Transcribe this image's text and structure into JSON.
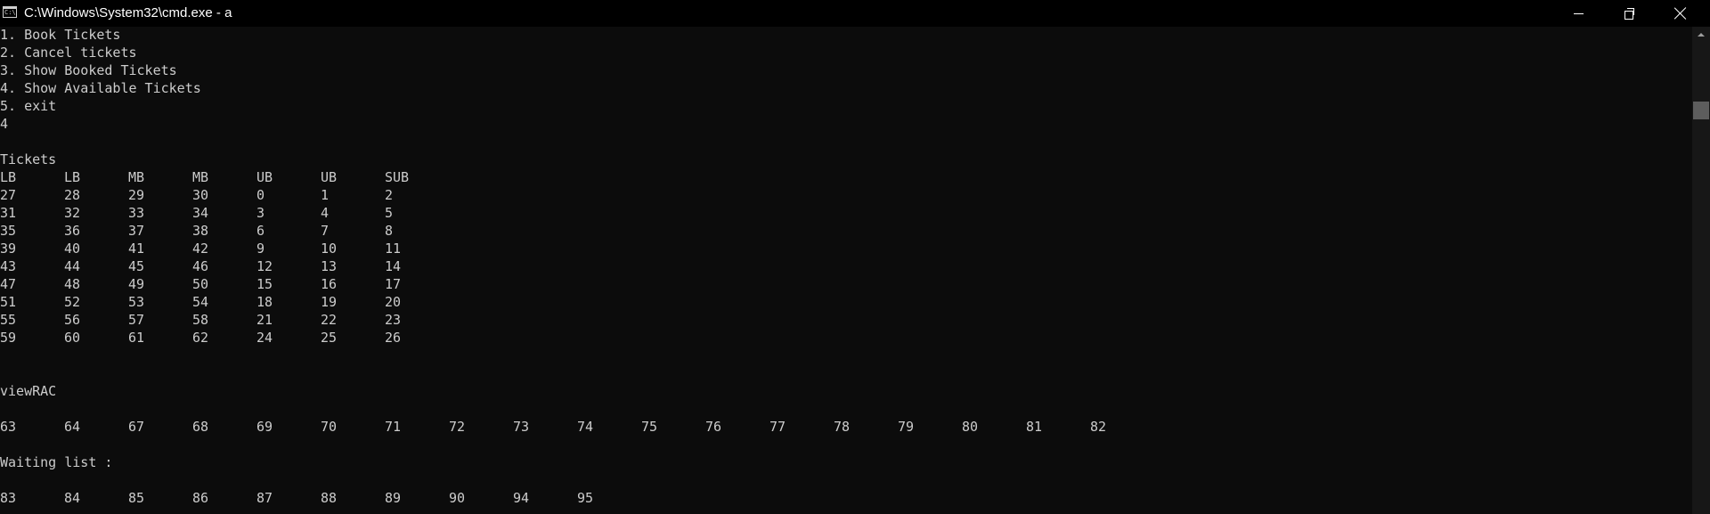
{
  "window": {
    "title": "C:\\Windows\\System32\\cmd.exe - a",
    "icon_text": "C:\\",
    "controls": [
      "minimize-icon",
      "restore-icon",
      "close-icon"
    ]
  },
  "colors": {
    "background": "#0c0c0c",
    "text": "#cccccc",
    "titlebar": "#000000"
  },
  "console": {
    "menu": [
      "1. Book Tickets",
      "2. Cancel tickets",
      "3. Show Booked Tickets",
      "4. Show Available Tickets",
      "5. exit"
    ],
    "input": "4",
    "tickets_heading": "Tickets",
    "tickets_header": [
      "LB",
      "LB",
      "MB",
      "MB",
      "UB",
      "UB",
      "SUB"
    ],
    "tickets_rows": [
      [
        "27",
        "28",
        "29",
        "30",
        "0",
        "1",
        "2"
      ],
      [
        "31",
        "32",
        "33",
        "34",
        "3",
        "4",
        "5"
      ],
      [
        "35",
        "36",
        "37",
        "38",
        "6",
        "7",
        "8"
      ],
      [
        "39",
        "40",
        "41",
        "42",
        "9",
        "10",
        "11"
      ],
      [
        "43",
        "44",
        "45",
        "46",
        "12",
        "13",
        "14"
      ],
      [
        "47",
        "48",
        "49",
        "50",
        "15",
        "16",
        "17"
      ],
      [
        "51",
        "52",
        "53",
        "54",
        "18",
        "19",
        "20"
      ],
      [
        "55",
        "56",
        "57",
        "58",
        "21",
        "22",
        "23"
      ],
      [
        "59",
        "60",
        "61",
        "62",
        "24",
        "25",
        "26"
      ]
    ],
    "rac_heading": "viewRAC",
    "rac": [
      "63",
      "64",
      "67",
      "68",
      "69",
      "70",
      "71",
      "72",
      "73",
      "74",
      "75",
      "76",
      "77",
      "78",
      "79",
      "80",
      "81",
      "82"
    ],
    "waiting_heading": "Waiting list :",
    "waiting": [
      "83",
      "84",
      "85",
      "86",
      "87",
      "88",
      "89",
      "90",
      "94",
      "95"
    ]
  }
}
